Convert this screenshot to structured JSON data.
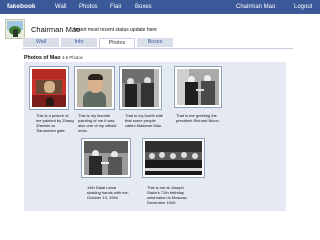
{
  "topbar": {
    "brand": "fakebook",
    "nav": [
      "Wall",
      "Photos",
      "Flair",
      "Boxes"
    ],
    "user": "Chairman Mao",
    "logout": "Logout"
  },
  "profile": {
    "name": "Chairman Mao",
    "status_prompt": "Insert most recent status update here"
  },
  "tabs": [
    "Wall",
    "Info",
    "Photos",
    "Boxes"
  ],
  "active_tab": "Photos",
  "photos_section": {
    "title": "Photos of Mao",
    "count": "4-6 Photos"
  },
  "photos": [
    {
      "caption": "This is a picture of me painted by Zhang Zhenshi at Tiananmen gate"
    },
    {
      "caption": "This is my favorite painting of me it was also one of my official ones."
    },
    {
      "caption": "That is my fourth wife that some people called Madame Mao."
    },
    {
      "caption": "That is me greeting the president Richard Nixon."
    },
    {
      "caption": "14th Dalai Lama shaking hands with me, October 13, 1954"
    },
    {
      "caption": "This is me at Joseph Stalin's 71th birthday celebration in Moscow, December 1949"
    }
  ],
  "colors": {
    "topbar": "#3b5998",
    "tab_inactive": "#d8dfea",
    "panel": "#e5e9f1",
    "photo_border": "#8fa2bf"
  }
}
